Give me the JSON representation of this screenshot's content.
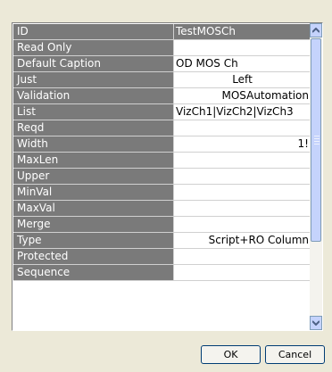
{
  "grid": {
    "header": {
      "label": "ID",
      "value": "TestMOSCh"
    },
    "rows": [
      {
        "label": "Read Only",
        "value": "",
        "align": "left"
      },
      {
        "label": "Default Caption",
        "value": "OD MOS Ch",
        "align": "left"
      },
      {
        "label": "Just",
        "value": "Left",
        "align": "center"
      },
      {
        "label": "Validation",
        "value": "MOSAutomation",
        "align": "right"
      },
      {
        "label": "List",
        "value": "VizCh1|VizCh2|VizCh3",
        "align": "left"
      },
      {
        "label": "Reqd",
        "value": "",
        "align": "left"
      },
      {
        "label": "Width",
        "value": "1!",
        "align": "right"
      },
      {
        "label": "MaxLen",
        "value": "",
        "align": "left"
      },
      {
        "label": "Upper",
        "value": "",
        "align": "left"
      },
      {
        "label": "MinVal",
        "value": "",
        "align": "left"
      },
      {
        "label": "MaxVal",
        "value": "",
        "align": "left"
      },
      {
        "label": "Merge",
        "value": "",
        "align": "left"
      },
      {
        "label": "Type",
        "value": "Script+RO Column",
        "align": "right"
      },
      {
        "label": "Protected",
        "value": "",
        "align": "left"
      },
      {
        "label": "Sequence",
        "value": "",
        "align": "left"
      }
    ]
  },
  "buttons": {
    "ok": "OK",
    "cancel": "Cancel"
  },
  "scrollbar": {
    "up_icon": "chevron-up-icon",
    "down_icon": "chevron-down-icon"
  }
}
